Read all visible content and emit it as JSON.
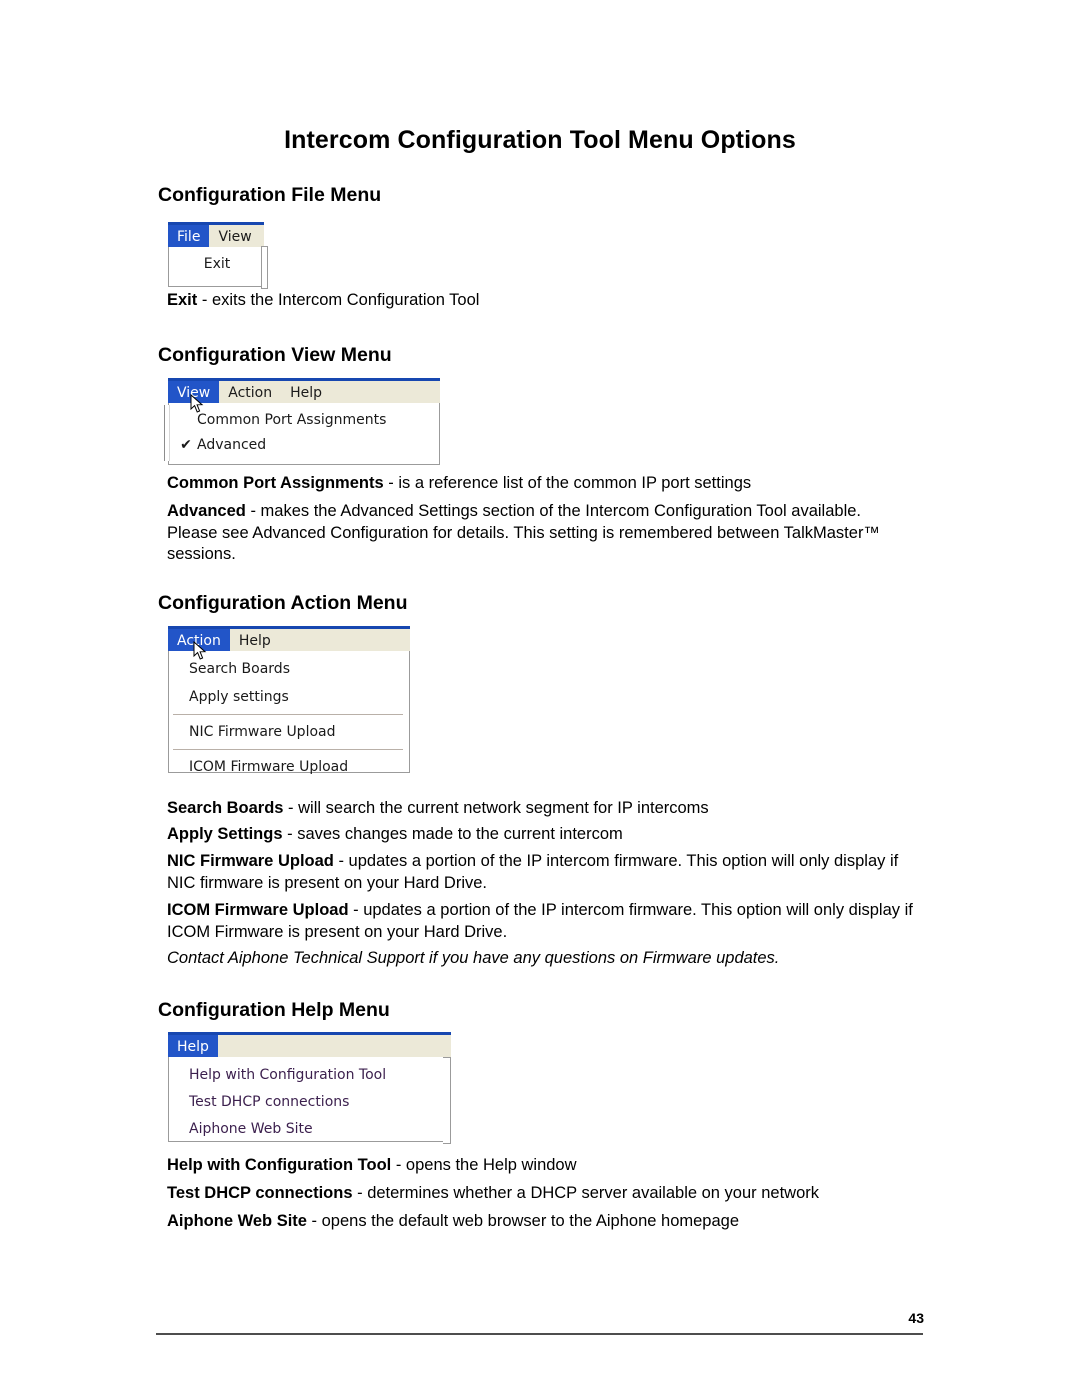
{
  "document": {
    "title": "Intercom Configuration Tool Menu Options",
    "page_number": "43"
  },
  "colors": {
    "menubar_bg": "#ece9d8",
    "menubar_top_border": "#1747b0",
    "selected_item_bg": "#2255c8",
    "selected_item_text": "#ffffff",
    "dropdown_bg": "#ffffff",
    "dropdown_border": "#9b9b9b",
    "help_item_text": "#3b1f4d"
  },
  "sections": [
    {
      "heading": "Configuration File Menu",
      "screenshot": {
        "menubar": [
          {
            "label": "File",
            "selected": true
          },
          {
            "label": "View",
            "selected": false
          }
        ],
        "dropdown": [
          {
            "label": "Exit",
            "checked": false
          }
        ]
      },
      "descriptions": [
        {
          "term": "Exit",
          "dash": " - ",
          "text": "exits the Intercom Configuration Tool"
        }
      ]
    },
    {
      "heading": "Configuration View Menu",
      "screenshot": {
        "menubar": [
          {
            "label": "View",
            "selected": true
          },
          {
            "label": "Action",
            "selected": false
          },
          {
            "label": "Help",
            "selected": false
          }
        ],
        "dropdown": [
          {
            "label": "Common Port Assignments",
            "checked": false
          },
          {
            "label": "Advanced",
            "checked": true,
            "check_glyph": "✔"
          }
        ]
      },
      "descriptions": [
        {
          "term": "Common Port Assignments",
          "dash": " - ",
          "text": "is a reference list of the common IP port settings"
        },
        {
          "term": "Advanced",
          "dash": " - ",
          "text": "makes the Advanced Settings section of the Intercom Configuration Tool available.  Please see Advanced Configuration for details.  This setting is remembered between TalkMaster™ sessions."
        }
      ]
    },
    {
      "heading": "Configuration Action Menu",
      "screenshot": {
        "menubar": [
          {
            "label": "Action",
            "selected": true
          },
          {
            "label": "Help",
            "selected": false
          }
        ],
        "dropdown": [
          {
            "label": "Search Boards",
            "checked": false
          },
          {
            "label": "Apply settings",
            "checked": false
          },
          {
            "separator": true
          },
          {
            "label": "NIC Firmware Upload",
            "checked": false
          },
          {
            "separator": true
          },
          {
            "label": "ICOM Firmware Upload",
            "checked": false
          }
        ]
      },
      "descriptions": [
        {
          "term": "Search Boards",
          "dash": " - ",
          "text": "will search the current network segment for IP intercoms"
        },
        {
          "term": "Apply Settings",
          "dash": " - ",
          "text": "saves changes made to the current intercom"
        },
        {
          "term": "NIC Firmware Upload",
          "dash": " - ",
          "text": "updates a portion of the IP intercom firmware.  This option will only display if NIC firmware is present on your Hard Drive."
        },
        {
          "term": "ICOM Firmware Upload",
          "dash": " - ",
          "text": "updates a portion of the IP intercom firmware.  This option will only display if ICOM Firmware is present on your Hard Drive."
        }
      ],
      "note": "Contact Aiphone Technical Support if you have any questions on Firmware updates."
    },
    {
      "heading": "Configuration Help Menu",
      "screenshot": {
        "menubar": [
          {
            "label": "Help",
            "selected": true
          }
        ],
        "dropdown": [
          {
            "label": "Help with Configuration Tool",
            "checked": false
          },
          {
            "label": "Test DHCP connections",
            "checked": false
          },
          {
            "label": "Aiphone Web Site",
            "checked": false
          }
        ]
      },
      "descriptions": [
        {
          "term": "Help with Configuration Tool",
          "dash": " - ",
          "text": "opens the Help window"
        },
        {
          "term": "Test DHCP connections",
          "dash": " - ",
          "text": "determines whether a DHCP server available on your network"
        },
        {
          "term": "Aiphone Web Site",
          "dash": " - ",
          "text": "opens the default web browser to the Aiphone homepage"
        }
      ]
    }
  ]
}
